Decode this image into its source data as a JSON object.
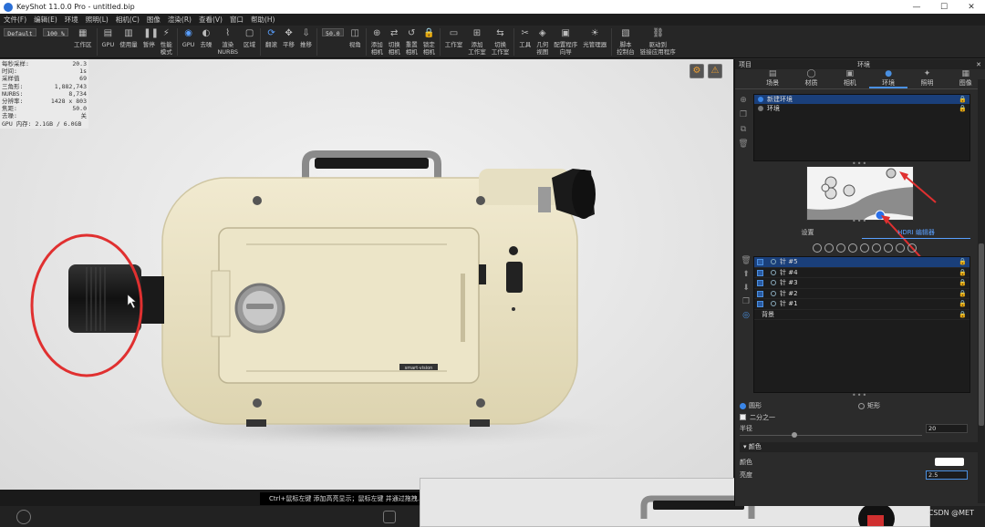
{
  "window": {
    "title": "KeyShot 11.0.0 Pro  - untitled.bip",
    "controls": [
      "—",
      "☐",
      "✕"
    ]
  },
  "menu": [
    "文件(F)",
    "编辑(E)",
    "环境",
    "照明(L)",
    "相机(C)",
    "图像",
    "渲染(R)",
    "查看(V)",
    "窗口",
    "帮助(H)"
  ],
  "toolbar": {
    "preset_value": "Default",
    "zoom_value": "100 %",
    "fov_value": "50.0",
    "items": [
      {
        "label": "工作区",
        "icon": "workspace-icon"
      },
      {
        "label": "GPU",
        "icon": "gpu-icon"
      },
      {
        "label": "使用量",
        "icon": "usage-icon"
      },
      {
        "label": "暂停",
        "icon": "pause-icon"
      },
      {
        "label": "性能\n模式",
        "icon": "performance-icon"
      },
      {
        "label": "GPU",
        "icon": "gpu-toggle-icon",
        "active": true
      },
      {
        "label": "去噪",
        "icon": "denoise-icon"
      },
      {
        "label": "渲染\nNURBS",
        "icon": "nurbs-icon"
      },
      {
        "label": "区域",
        "icon": "region-icon"
      },
      {
        "label": "翻滚",
        "icon": "tumble-icon",
        "active": true
      },
      {
        "label": "平移",
        "icon": "pan-icon"
      },
      {
        "label": "推移",
        "icon": "dolly-icon"
      },
      {
        "label": "视角",
        "icon": "fov-icon"
      },
      {
        "label": "添加\n相机",
        "icon": "add-camera-icon"
      },
      {
        "label": "切换\n相机",
        "icon": "switch-camera-icon"
      },
      {
        "label": "重置\n相机",
        "icon": "reset-camera-icon"
      },
      {
        "label": "锁定\n相机",
        "icon": "lock-camera-icon"
      },
      {
        "label": "工作室",
        "icon": "studio-icon"
      },
      {
        "label": "添加\n工作室",
        "icon": "add-studio-icon"
      },
      {
        "label": "切换\n工作室",
        "icon": "switch-studio-icon"
      },
      {
        "label": "工具",
        "icon": "tools-icon"
      },
      {
        "label": "几何\n视图",
        "icon": "geometry-view-icon"
      },
      {
        "label": "配置程序\n向导",
        "icon": "configurator-icon"
      },
      {
        "label": "光管理器",
        "icon": "light-manager-icon"
      },
      {
        "label": "脚本\n控制台",
        "icon": "script-console-icon"
      },
      {
        "label": "驱动到\n链接应用程序",
        "icon": "link-app-icon"
      }
    ]
  },
  "stats": [
    {
      "k": "每秒采样:",
      "v": "20.3"
    },
    {
      "k": "时间:",
      "v": "1s"
    },
    {
      "k": "采样值",
      "v": "69"
    },
    {
      "k": "三角形:",
      "v": "1,882,743"
    },
    {
      "k": "NURBS:",
      "v": "8,734"
    },
    {
      "k": "分辨率:",
      "v": "1428 x 803"
    },
    {
      "k": "焦距:",
      "v": "50.0"
    },
    {
      "k": "去噪:",
      "v": "关"
    },
    {
      "k": "GPU 内存: 2.1GB / 6.0GB",
      "v": ""
    }
  ],
  "hint": "Ctrl+鼠标左键 添加高亮显示；鼠标左键 并通过拖拽...",
  "panel": {
    "header_left": "项目",
    "header_title": "环境",
    "tabs": [
      {
        "label": "场景",
        "icon": "scene-icon"
      },
      {
        "label": "材质",
        "icon": "material-icon"
      },
      {
        "label": "相机",
        "icon": "camera-icon"
      },
      {
        "label": "环境",
        "icon": "environment-icon",
        "active": true
      },
      {
        "label": "照明",
        "icon": "lighting-icon"
      },
      {
        "label": "图像",
        "icon": "image-icon"
      }
    ],
    "env_items": [
      "新建环境",
      "环境"
    ],
    "subtabs": [
      "设置",
      "HDRI 编辑器"
    ],
    "pins": [
      "针 #5",
      "针 #4",
      "针 #3",
      "针 #2",
      "针 #1"
    ],
    "background_label": "背景",
    "shape_options": [
      "圆形",
      "矩形"
    ],
    "half_label": "二分之一",
    "radius_label": "半径",
    "radius_value": "20",
    "color_section": "颜色",
    "color_label": "颜色",
    "brightness_label": "亮度",
    "brightness_value": "2.5"
  },
  "bottom": {
    "watermark": "CSDN @MET",
    "right_label": "动画"
  },
  "colors": {
    "accent": "#3a86e8",
    "camera_body": "#ebe4c5",
    "annotation_red": "#e03030"
  }
}
